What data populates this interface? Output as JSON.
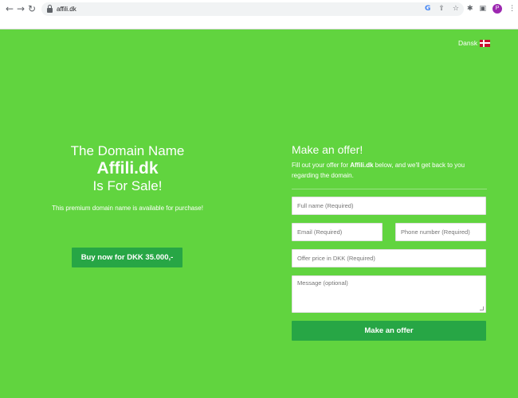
{
  "browser": {
    "url": "affili.dk",
    "back": "←",
    "forward": "→",
    "reload": "↻",
    "google_icon": "G",
    "share_icon": "⇪",
    "star_icon": "☆",
    "extensions_icon": "✱",
    "sidepanel_icon": "▣",
    "profile_initial": "P",
    "menu_icon": "⋮",
    "profile_color": "#9c27b0"
  },
  "language": {
    "label": "Dansk"
  },
  "hero": {
    "line1": "The Domain Name",
    "domain": "Affili.dk",
    "line3": "Is For Sale!",
    "subtitle": "This premium domain name is available for purchase!",
    "buy_button": "Buy now for DKK 35.000,-"
  },
  "offer": {
    "title": "Make an offer!",
    "desc_prefix": "Fill out your offer for ",
    "desc_domain": "Affili.dk",
    "desc_suffix": " below, and we'll get back to you regarding the domain.",
    "fields": {
      "full_name": "Full name (Required)",
      "email": "Email (Required)",
      "phone": "Phone number (Required)",
      "price": "Offer price in DKK (Required)",
      "message": "Message (optional)"
    },
    "submit": "Make an offer"
  },
  "colors": {
    "background": "#61d43f",
    "button": "#27a645"
  }
}
